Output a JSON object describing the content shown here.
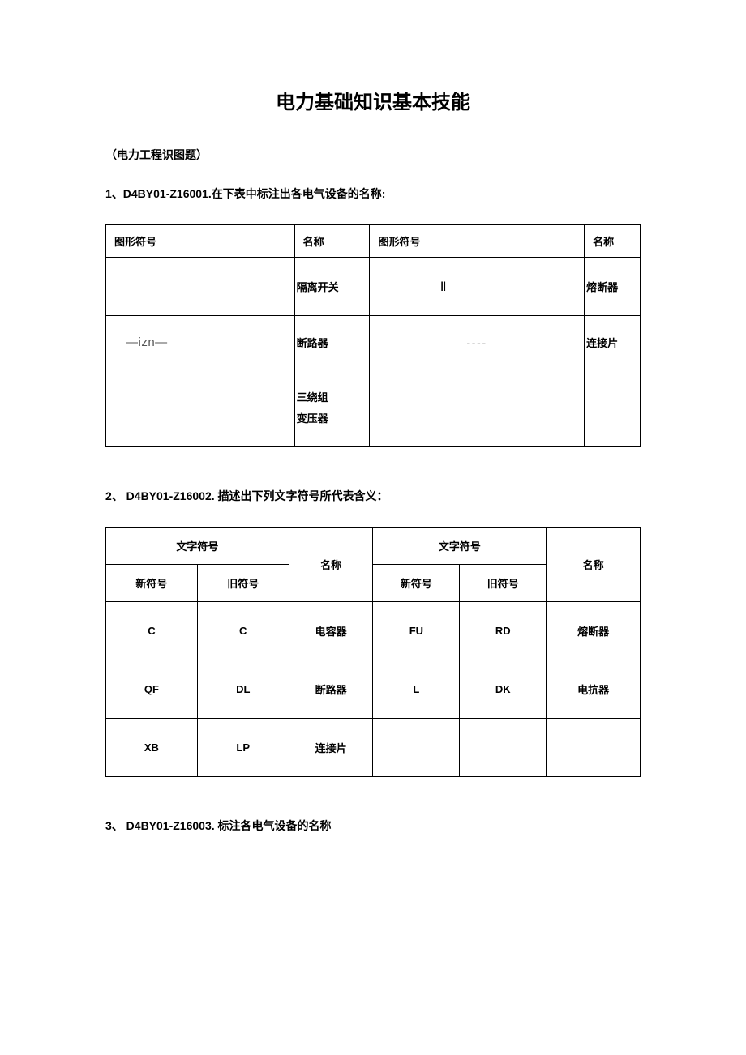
{
  "title": "电力基础知识基本技能",
  "subtitle": "（电力工程识图题）",
  "q1": {
    "label": "1、D4BY01-Z16001.在下表中标注出各电气设备的名称:",
    "headers": {
      "sym": "图形符号",
      "name": "名称"
    },
    "rows": [
      {
        "s1": "",
        "n1": "隔离开关",
        "s2_txt": "Ⅱ",
        "n2": "熔断器"
      },
      {
        "s1": "—izn—",
        "n1": "断路器",
        "s2_txt": "----",
        "n2": "连接片"
      },
      {
        "s1": "",
        "n1_a": "三绕组",
        "n1_b": "变压器",
        "s2_txt": "",
        "n2": ""
      }
    ]
  },
  "q2": {
    "label": "2、  D4BY01-Z16002. 描述出下列文字符号所代表含义：",
    "headers": {
      "txtsym": "文字符号",
      "name": "名称",
      "newsym": "新符号",
      "oldsym": "旧符号"
    },
    "rows": [
      {
        "new1": "C",
        "old1": "C",
        "name1": "电容器",
        "new2": "FU",
        "old2": "RD",
        "name2": "熔断器"
      },
      {
        "new1": "QF",
        "old1": "DL",
        "name1": "断路器",
        "new2": "L",
        "old2": "DK",
        "name2": "电抗器"
      },
      {
        "new1": "XB",
        "old1": "LP",
        "name1": "连接片",
        "new2": "",
        "old2": "",
        "name2": ""
      }
    ]
  },
  "q3": {
    "label": "3、  D4BY01-Z16003. 标注各电气设备的名称"
  }
}
